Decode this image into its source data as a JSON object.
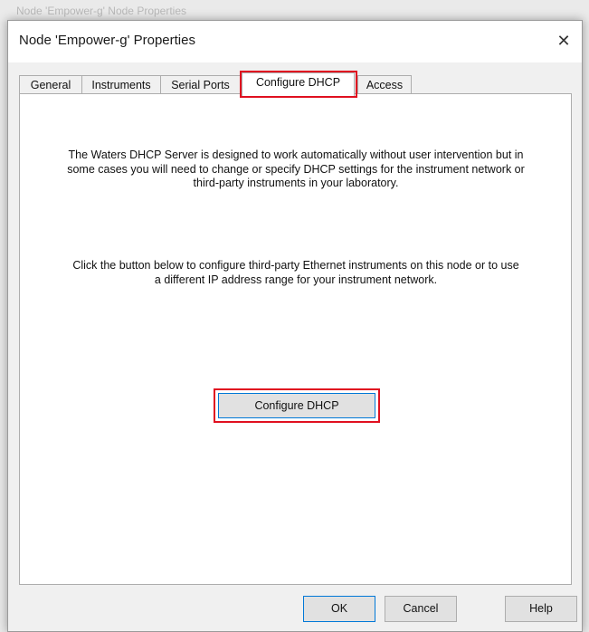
{
  "window": {
    "title": "Node 'Empower-g' Properties",
    "close_glyph": "✕",
    "background_title": "Node 'Empower-g' Node Properties"
  },
  "tabs": [
    {
      "label": "General",
      "active": false
    },
    {
      "label": "Instruments",
      "active": false
    },
    {
      "label": "Serial Ports",
      "active": false
    },
    {
      "label": "Configure DHCP",
      "active": true
    },
    {
      "label": "Access",
      "active": false
    }
  ],
  "panel": {
    "paragraph1": "The Waters DHCP Server is designed to work automatically without user intervention but in some cases you will need to change or specify DHCP settings for the instrument network or third-party instruments in your laboratory.",
    "paragraph2": "Click the button below to configure third-party Ethernet instruments on this node or to use a different IP address range for your instrument network.",
    "configure_button": "Configure DHCP"
  },
  "footer": {
    "ok": "OK",
    "cancel": "Cancel",
    "help": "Help"
  },
  "colors": {
    "highlight": "#e01020",
    "focus": "#0078d7"
  }
}
